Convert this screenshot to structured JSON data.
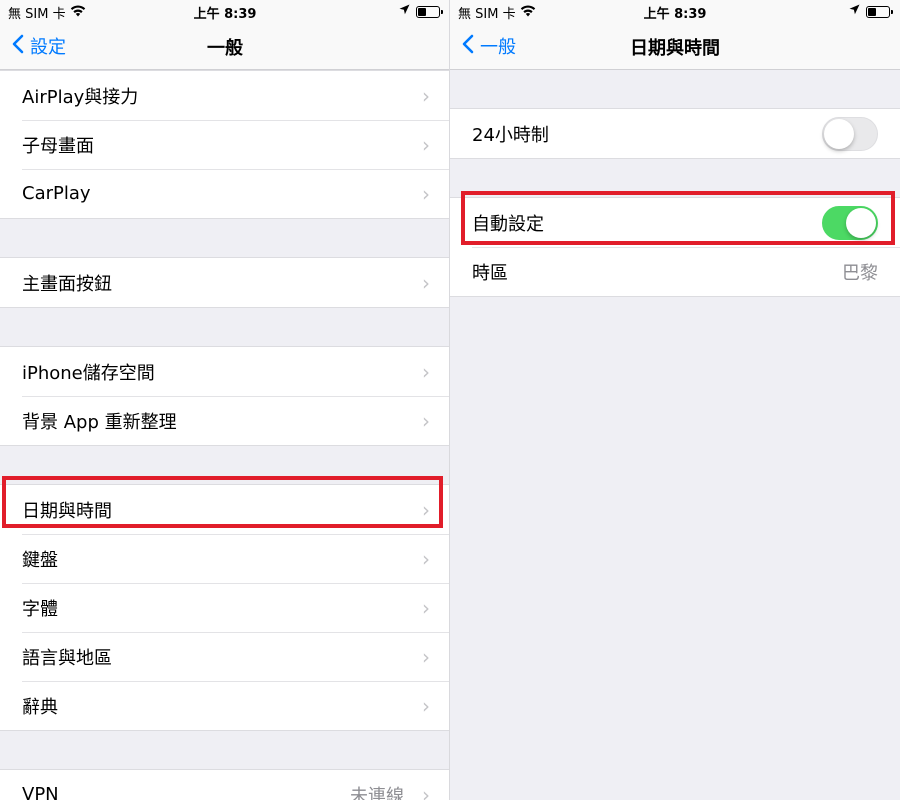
{
  "left": {
    "status": {
      "carrier": "無 SIM 卡",
      "time": "上午 8:39"
    },
    "nav": {
      "back_label": "設定",
      "title": "一般"
    },
    "groups": [
      [
        {
          "label": "AirPlay與接力"
        },
        {
          "label": "子母畫面"
        },
        {
          "label": "CarPlay"
        }
      ],
      [
        {
          "label": "主畫面按鈕"
        }
      ],
      [
        {
          "label": "iPhone儲存空間"
        },
        {
          "label": "背景 App 重新整理"
        }
      ],
      [
        {
          "label": "日期與時間"
        },
        {
          "label": "鍵盤"
        },
        {
          "label": "字體"
        },
        {
          "label": "語言與地區"
        },
        {
          "label": "辭典"
        }
      ],
      [
        {
          "label": "VPN",
          "value": "未連線"
        }
      ]
    ]
  },
  "right": {
    "status": {
      "carrier": "無 SIM 卡",
      "time": "上午 8:39"
    },
    "nav": {
      "back_label": "一般",
      "title": "日期與時間"
    },
    "rows": {
      "clock24": {
        "label": "24小時制",
        "on": false
      },
      "auto_set": {
        "label": "自動設定",
        "on": true
      },
      "timezone": {
        "label": "時區",
        "value": "巴黎"
      }
    }
  },
  "colors": {
    "accent": "#007aff",
    "highlight": "#e11d2a",
    "toggle_on": "#4cd964"
  }
}
